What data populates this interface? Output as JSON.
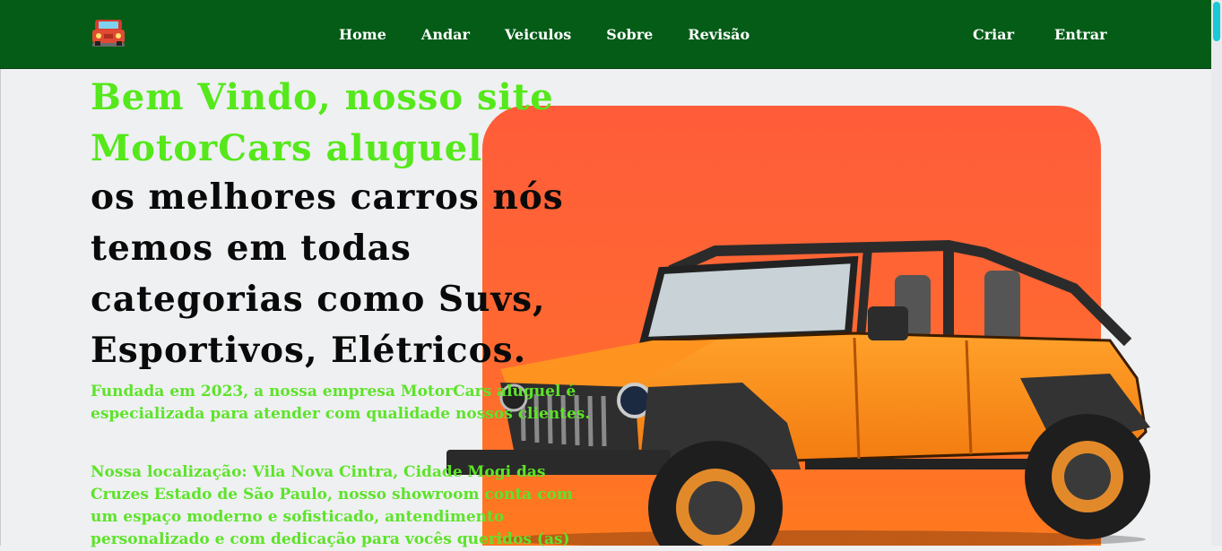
{
  "nav": {
    "logo_icon": "car-icon",
    "links": [
      "Home",
      "Andar",
      "Veiculos",
      "Sobre",
      "Revisão"
    ],
    "right_links": [
      "Criar",
      "Entrar"
    ]
  },
  "hero": {
    "welcome_line1": "Bem Vindo, nosso site",
    "welcome_line2": "MotorCars aluguel",
    "tagline": "os melhores carros nós temos em todas categorias como Suvs, Esportivos, Elétricos.",
    "paragraph1": "Fundada em 2023, a nossa empresa MotorCars aluguel é especializada para atender com qualidade nossos clientes.",
    "paragraph2": "Nossa localização: Vila Nova Cintra, Cidade Mogi das Cruzes Estado de São Paulo, nosso showroom conta com um espaço moderno e sofisticado, antendimento personalizado e com dedicação para vocês queridos (as)",
    "image": "orange-jeep-image"
  },
  "colors": {
    "navbar": "#045c17",
    "accent_green": "#55e81a",
    "hero_orange": "#ff5c3a",
    "jeep_orange": "#ff8a1a"
  }
}
